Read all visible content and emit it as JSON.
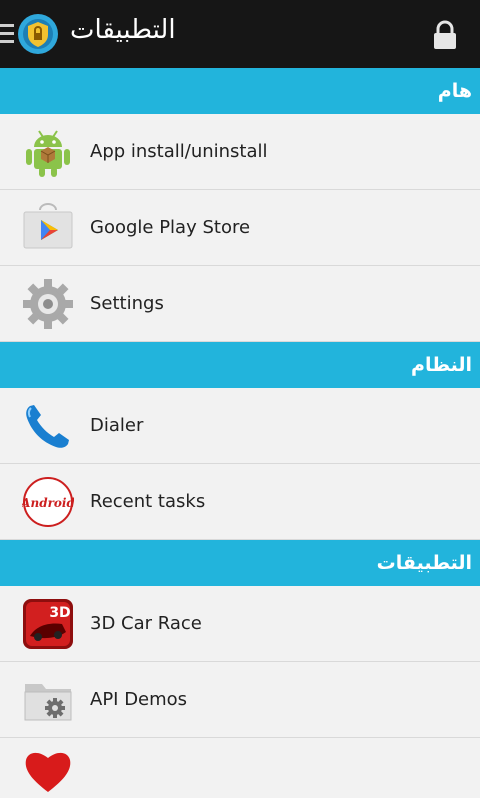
{
  "appbar": {
    "title": "التطبيقات"
  },
  "sections": {
    "important": "هام",
    "system": "النظام",
    "apps": "التطبيقات"
  },
  "items": {
    "app_install": "App install/uninstall",
    "play_store": "Google Play Store",
    "settings": "Settings",
    "dialer": "Dialer",
    "recent_tasks": "Recent tasks",
    "car_race": "3D Car Race",
    "api_demos": "API Demos"
  },
  "icon_text": {
    "recent_tasks_logo": "Android",
    "car_race_logo": "3D"
  },
  "colors": {
    "section_header": "#22b4dc",
    "appbar": "#161616"
  }
}
